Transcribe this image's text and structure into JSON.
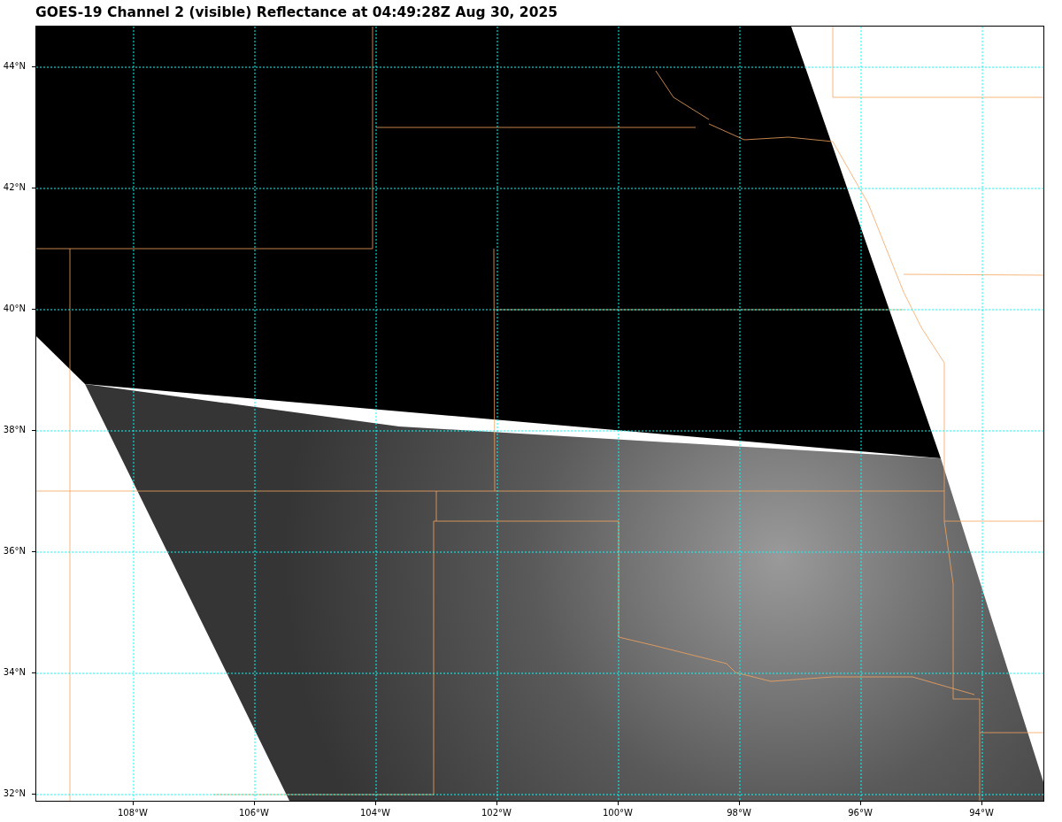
{
  "title": "GOES-19 Channel 2 (visible) Reflectance at 04:49:28Z Aug 30, 2025",
  "y_axis_labels": [
    "44°N",
    "42°N",
    "40°N",
    "38°N",
    "36°N",
    "34°N",
    "32°N"
  ],
  "x_axis_labels": [
    "108°W",
    "106°W",
    "104°W",
    "102°W",
    "100°W",
    "98°W",
    "96°W",
    "94°W"
  ]
}
